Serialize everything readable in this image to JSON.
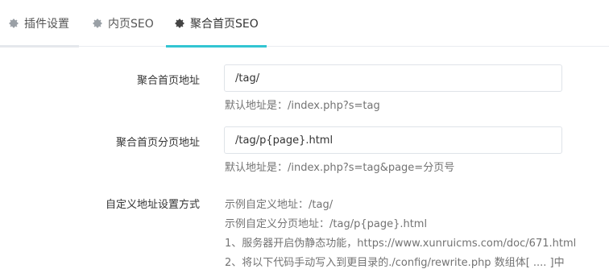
{
  "tabs": [
    {
      "label": "插件设置",
      "icon": "gear-icon"
    },
    {
      "label": "内页SEO",
      "icon": "gear-icon"
    },
    {
      "label": "聚合首页SEO",
      "icon": "gear-icon",
      "active": true
    }
  ],
  "colors": {
    "active_tab_underline": "#32c5d2",
    "inactive_tab_underline": "#e5e8ec"
  },
  "form": {
    "home_url": {
      "label": "聚合首页地址",
      "value": "/tag/",
      "hint": "默认地址是：/index.php?s=tag"
    },
    "home_page_url": {
      "label": "聚合首页分页地址",
      "value": "/tag/p{page}.html",
      "hint": "默认地址是：/index.php?s=tag&page=分页号"
    },
    "custom_method": {
      "label": "自定义地址设置方式",
      "lines": [
        "示例自定义地址：/tag/",
        "示例自定义分页地址：/tag/p{page}.html",
        "1、服务器开启伪静态功能，https://www.xunruicms.com/doc/671.html",
        "2、将以下代码手动写入到更目录的./config/rewrite.php 数组体[ .... ]中"
      ]
    }
  }
}
